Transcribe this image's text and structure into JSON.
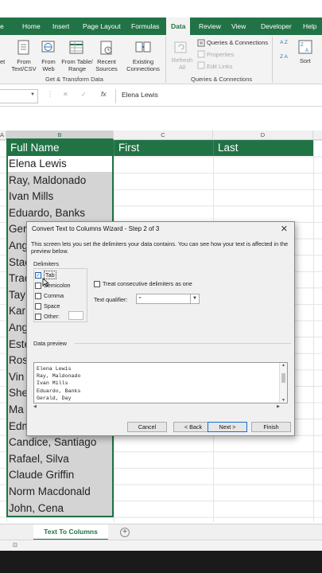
{
  "ribbon": {
    "tabs": [
      "e",
      "Home",
      "Insert",
      "Page Layout",
      "Formulas",
      "Data",
      "Review",
      "View",
      "Developer",
      "Help"
    ],
    "active_tab": "Data",
    "get_transform": {
      "buttons": [
        {
          "line1": "et",
          "line2": ""
        },
        {
          "line1": "From",
          "line2": "Text/CSV"
        },
        {
          "line1": "From",
          "line2": "Web"
        },
        {
          "line1": "From Table/",
          "line2": "Range"
        },
        {
          "line1": "Recent",
          "line2": "Sources"
        },
        {
          "line1": "Existing",
          "line2": "Connections"
        }
      ],
      "group_label": "Get & Transform Data"
    },
    "queries": {
      "refresh_line1": "Refresh",
      "refresh_line2": "All",
      "queries_connections": "Queries & Connections",
      "properties": "Properties",
      "edit_links": "Edit Links",
      "group_label": "Queries & Connections"
    },
    "sort": {
      "sort_label": "Sort",
      "az": "A Z",
      "za": "Z A"
    }
  },
  "formula_bar": {
    "cancel": "✕",
    "enter": "✓",
    "fx": "fx",
    "value": "Elena Lewis"
  },
  "columns": [
    "A",
    "B",
    "C",
    "D"
  ],
  "sheet": {
    "headers": {
      "full_name": "Full Name",
      "first": "First",
      "last": "Last"
    },
    "names": [
      "Elena Lewis",
      "Ray, Maldonado",
      "Ivan Mills",
      "Eduardo, Banks",
      "Ger",
      "Ang",
      "Stac",
      "Trac",
      "Tay",
      "Kar",
      "Ang",
      "Este",
      "Ros",
      "Vin",
      "She",
      "Ma",
      "Edm",
      "Candice, Santiago",
      "Rafael, Silva",
      "Claude Griffin",
      "Norm Macdonald",
      "John, Cena"
    ]
  },
  "sheet_tab": {
    "name": "Text To Columns",
    "add": "+"
  },
  "dialog": {
    "title": "Convert Text to Columns Wizard - Step 2 of 3",
    "close": "✕",
    "description": "This screen lets you set the delimiters your data contains.  You can see how your text is affected in the preview below.",
    "delimiters_label": "Delimiters",
    "tab_label": "Tab",
    "semicolon_label": "Semicolon",
    "comma_label": "Comma",
    "space_label": "Space",
    "other_label": "Other:",
    "consecutive_label": "Treat consecutive delimiters as one",
    "qualifier_label": "Text qualifier:",
    "qualifier_value": "\"",
    "preview_label": "Data preview",
    "preview_lines": [
      "Elena Lewis",
      "Ray, Maldonado",
      "Ivan Mills",
      "Eduardo, Banks",
      "Gerald, Day"
    ],
    "buttons": {
      "cancel": "Cancel",
      "back": "< Back",
      "next": "Next >",
      "finish": "Finish"
    },
    "tab_checked": true
  }
}
